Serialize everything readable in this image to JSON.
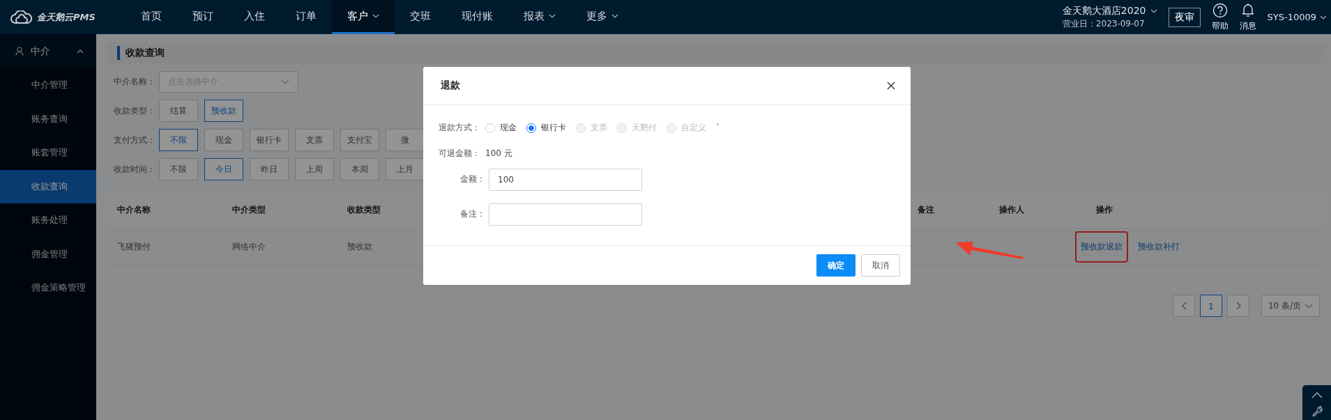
{
  "header": {
    "logo": "金天鹅云PMS",
    "nav": [
      {
        "label": "首页",
        "selected": false,
        "dropdown": false
      },
      {
        "label": "预订",
        "selected": false,
        "dropdown": false
      },
      {
        "label": "入住",
        "selected": false,
        "dropdown": false
      },
      {
        "label": "订单",
        "selected": false,
        "dropdown": false
      },
      {
        "label": "客户",
        "selected": true,
        "dropdown": true
      },
      {
        "label": "交班",
        "selected": false,
        "dropdown": false
      },
      {
        "label": "现付账",
        "selected": false,
        "dropdown": false
      },
      {
        "label": "报表",
        "selected": false,
        "dropdown": true
      },
      {
        "label": "更多",
        "selected": false,
        "dropdown": true
      }
    ],
    "hotel": "金天鹅大酒店2020",
    "business_day": "营业日：2023-09-07",
    "night_audit": "夜审",
    "help": "帮助",
    "messages": "消息",
    "user": "SYS-10009"
  },
  "sidebar": {
    "group": {
      "label": "中介",
      "expanded": true
    },
    "items": [
      {
        "label": "中介管理",
        "selected": false
      },
      {
        "label": "账务查询",
        "selected": false
      },
      {
        "label": "账套管理",
        "selected": false
      },
      {
        "label": "收款查询",
        "selected": true
      },
      {
        "label": "账务处理",
        "selected": false
      },
      {
        "label": "佣金管理",
        "selected": false
      },
      {
        "label": "佣金策略管理",
        "selected": false
      }
    ]
  },
  "page_title": "收款查询",
  "filters": {
    "agent": {
      "label": "中介名称：",
      "placeholder": "点击选择中介"
    },
    "groups": [
      {
        "label": "收款类型：",
        "options": [
          {
            "label": "结算",
            "selected": false
          },
          {
            "label": "预收款",
            "selected": true
          }
        ]
      },
      {
        "label": "支付方式：",
        "options": [
          {
            "label": "不限",
            "selected": true
          },
          {
            "label": "现金",
            "selected": false
          },
          {
            "label": "银行卡",
            "selected": false
          },
          {
            "label": "支票",
            "selected": false
          },
          {
            "label": "支付宝",
            "selected": false
          },
          {
            "label": "微",
            "selected": false
          }
        ]
      },
      {
        "label": "收款时间：",
        "options": [
          {
            "label": "不限",
            "selected": false
          },
          {
            "label": "今日",
            "selected": true
          },
          {
            "label": "昨日",
            "selected": false
          },
          {
            "label": "上周",
            "selected": false
          },
          {
            "label": "本周",
            "selected": false
          },
          {
            "label": "上月",
            "selected": false
          }
        ]
      }
    ]
  },
  "table": {
    "columns": [
      "中介名称",
      "中介类型",
      "收款类型",
      "备注",
      "操作人",
      "操作"
    ],
    "rows": [
      {
        "cells": [
          "飞猪预付",
          "网络中介",
          "预收款"
        ],
        "actions": [
          {
            "label": "预收款退款",
            "highlighted": true
          },
          {
            "label": "预收款补打",
            "highlighted": false
          }
        ]
      }
    ]
  },
  "pagination": {
    "pages": [
      {
        "label": "1",
        "selected": true
      }
    ],
    "page_size": "10 条/页"
  },
  "dialog": {
    "title": "退款",
    "method_label": "退款方式：",
    "methods": [
      {
        "label": "现金",
        "selected": false,
        "disabled": false
      },
      {
        "label": "银行卡",
        "selected": true,
        "disabled": false
      },
      {
        "label": "支票",
        "selected": false,
        "disabled": true
      },
      {
        "label": "天鹅付",
        "selected": false,
        "disabled": true
      },
      {
        "label": "自定义",
        "selected": false,
        "disabled": true
      }
    ],
    "trailing_mark": "`",
    "refundable_label": "可退金额：",
    "refundable_value": "100 元",
    "fields": [
      {
        "label": "金额：",
        "value": "100"
      },
      {
        "label": "备注："
      }
    ],
    "buttons": [
      {
        "label": "确定",
        "kind": "primary"
      },
      {
        "label": "取消",
        "kind": "default"
      }
    ]
  }
}
